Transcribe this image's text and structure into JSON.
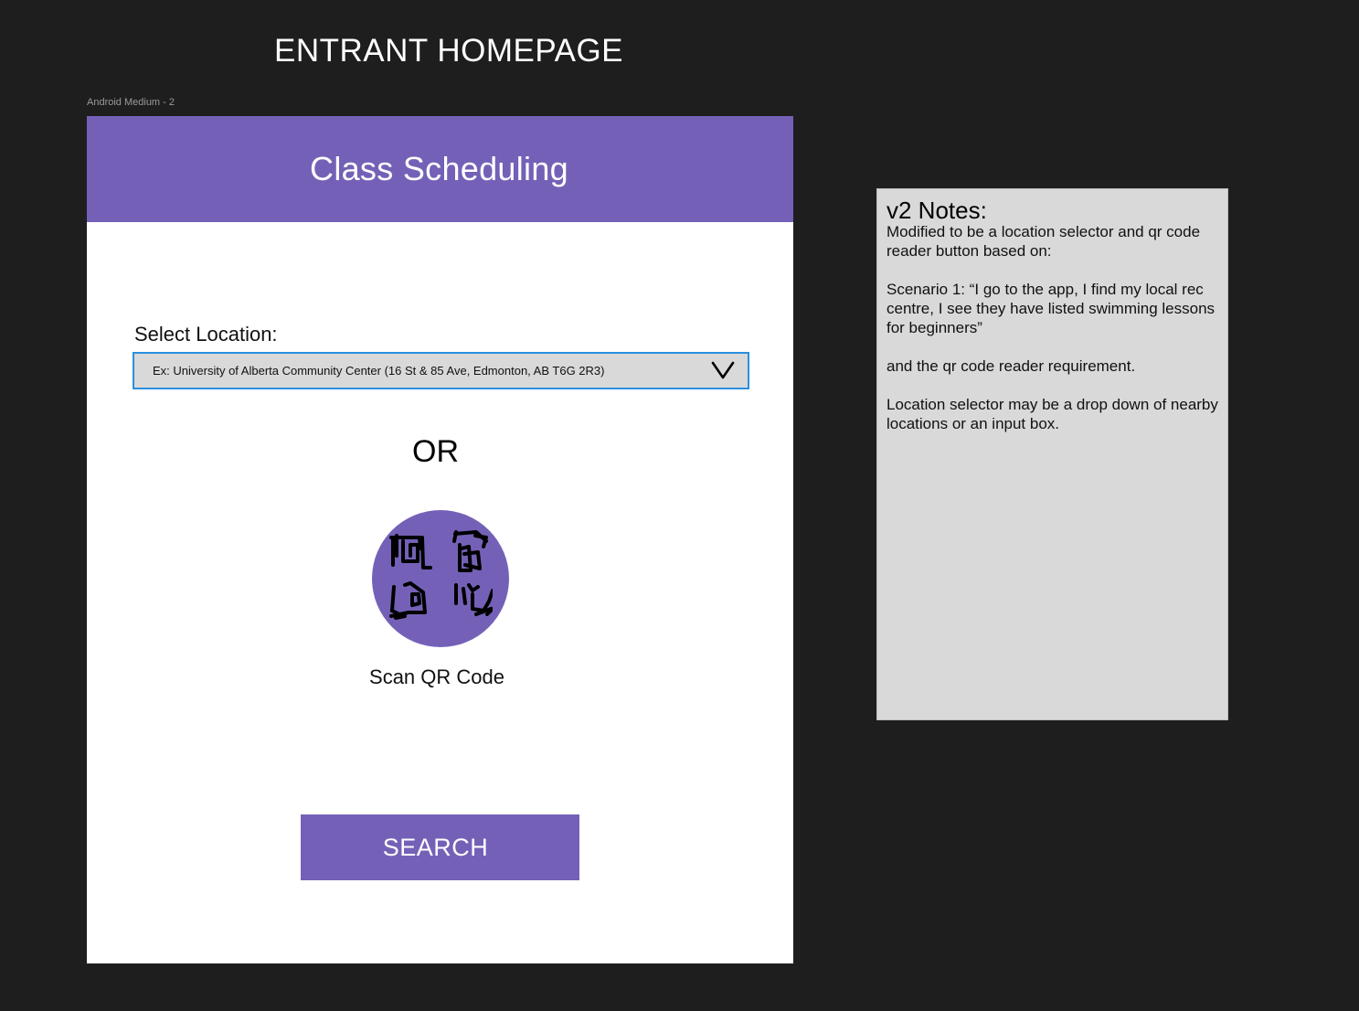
{
  "canvas": {
    "heading": "ENTRANT HOMEPAGE",
    "frame_label": "Android Medium - 2"
  },
  "app": {
    "title": "Class Scheduling",
    "location": {
      "label": "Select Location:",
      "value": "Ex: University of Alberta Community Center (16 St & 85 Ave, Edmonton, AB T6G 2R3)",
      "dropdown_icon": "chevron-down-icon"
    },
    "or_text": "OR",
    "qr": {
      "icon": "qr-code-icon",
      "label": "Scan QR Code"
    },
    "search_label": "SEARCH"
  },
  "notes": {
    "title": "v2 Notes:",
    "paragraphs": [
      "Modified to be a location selector and qr code reader button based on:",
      "Scenario 1: “I go to the app, I find my local rec centre, I see they have listed swimming lessons for beginners”",
      "and the qr code reader requirement.",
      "Location selector may be a drop down of nearby locations or an input box."
    ]
  },
  "colors": {
    "background": "#1e1e1e",
    "accent": "#7461b7",
    "panel": "#d9d9d9",
    "select_border": "#2a8fe0"
  }
}
